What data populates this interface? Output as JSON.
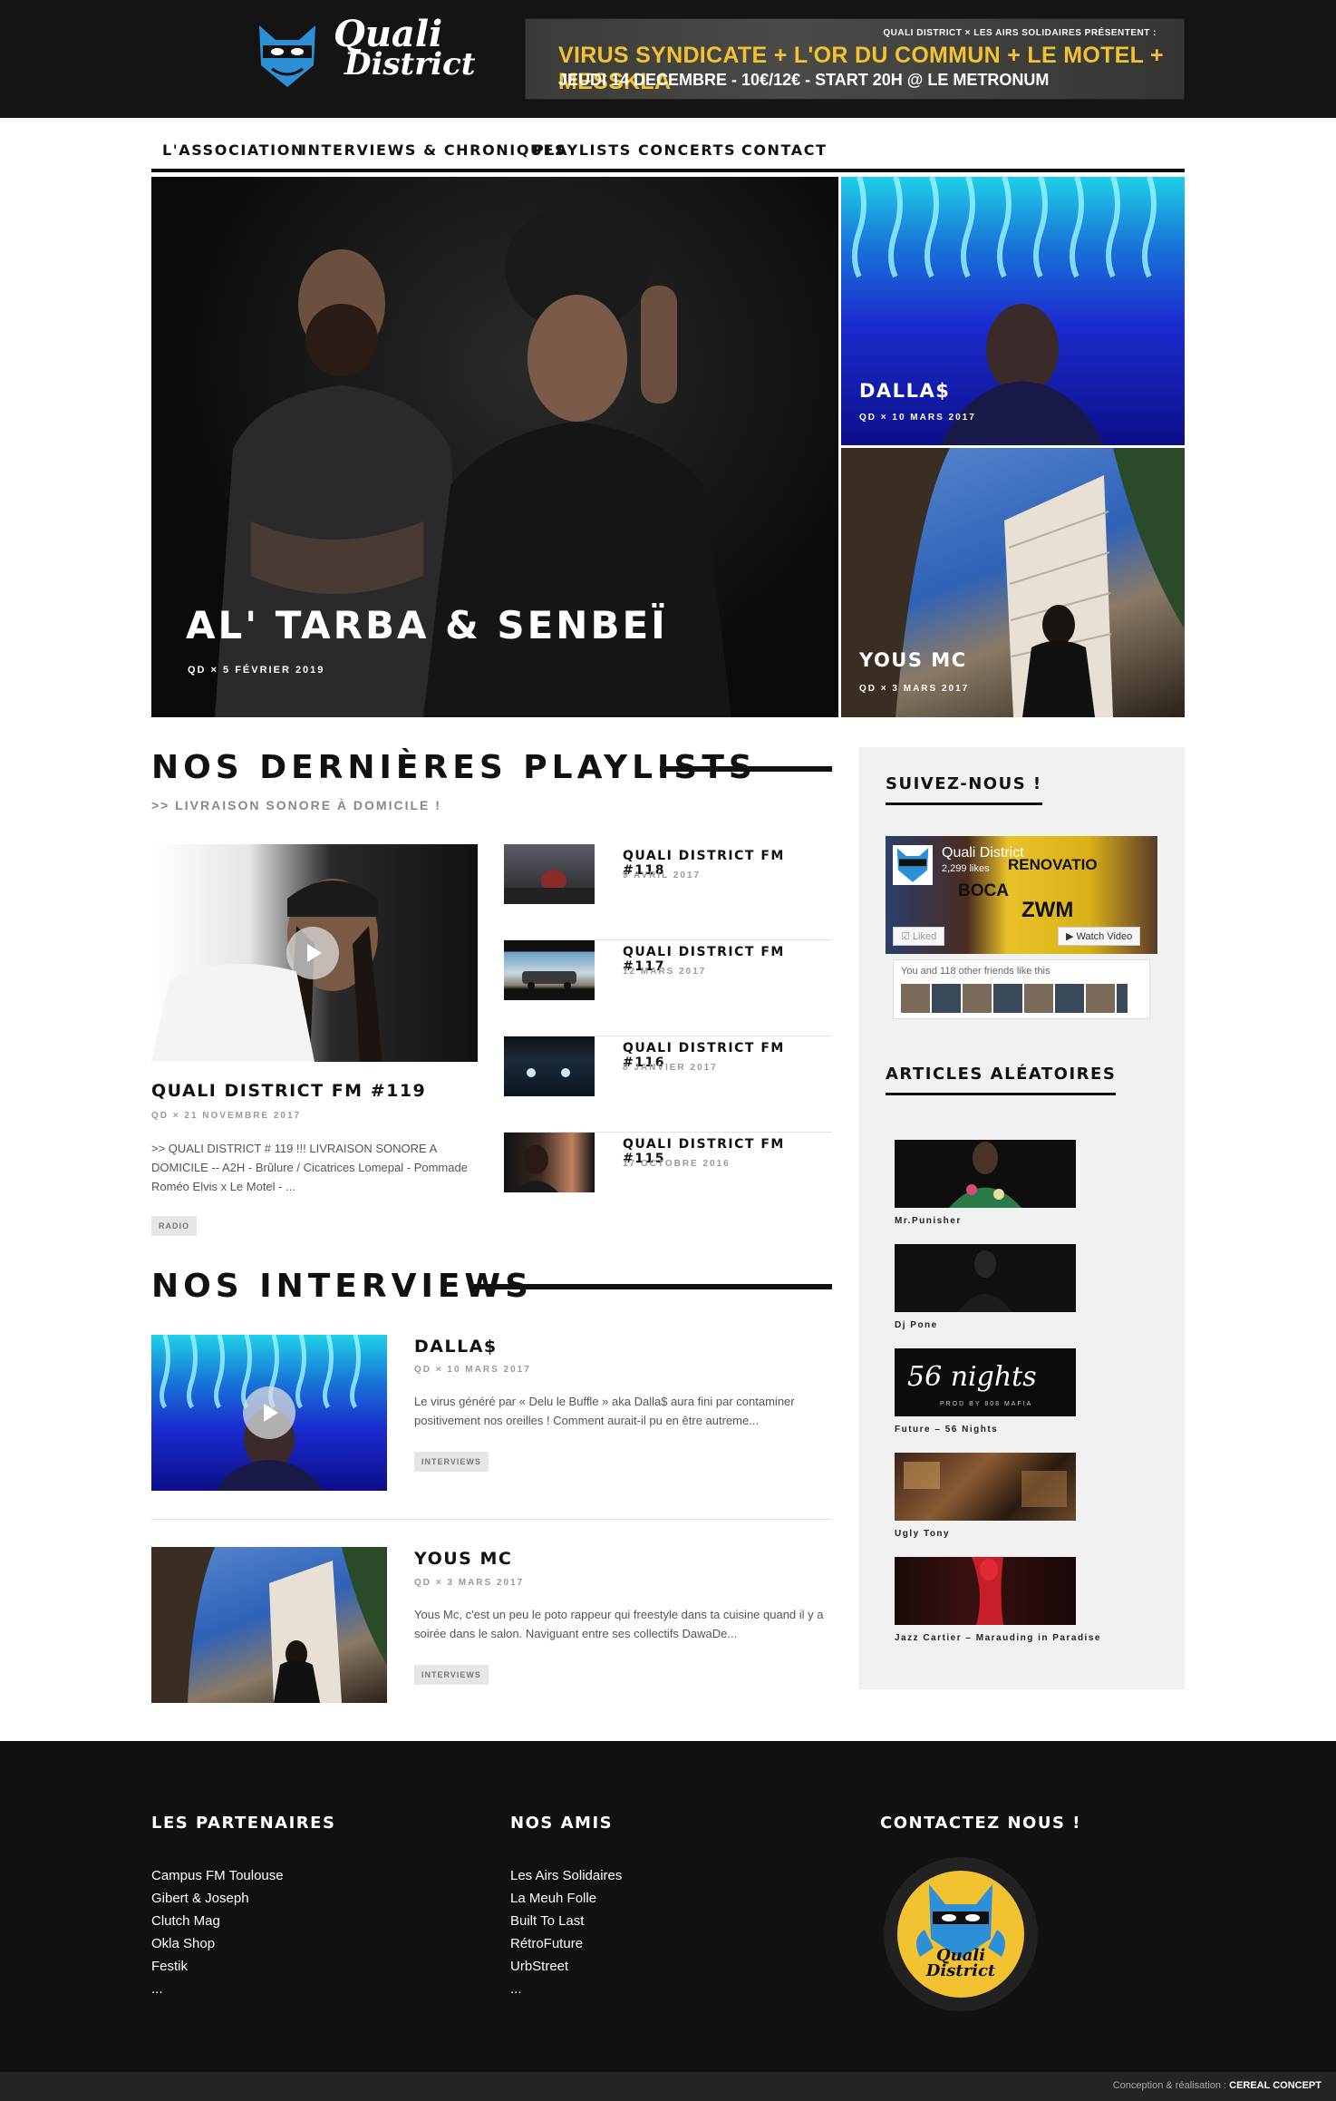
{
  "site": {
    "logo_line1": "Quali",
    "logo_line2": "District"
  },
  "banner": {
    "pre": "QUALI DISTRICT × LES AIRS SOLIDAIRES PRÉSENTENT :",
    "main": "VIRUS SYNDICATE + L'OR DU COMMUN + LE MOTEL + MESSKLA",
    "sub": "JEUDI 14 DECEMBRE - 10€/12€ - START 20H @ LE METRONUM"
  },
  "nav": [
    "L'ASSOCIATION",
    "INTERVIEWS & CHRONIQUES",
    "PLAYLISTS",
    "CONCERTS",
    "CONTACT"
  ],
  "hero": {
    "main": {
      "title": "AL' TARBA & SENBEÏ",
      "meta": "QD × 5 FÉVRIER 2019"
    },
    "dallas": {
      "title": "DALLA$",
      "meta": "QD × 10 MARS 2017"
    },
    "yous": {
      "title": "YOUS MC",
      "meta": "QD × 3 MARS 2017"
    }
  },
  "playlists": {
    "title": "NOS DERNIÈRES PLAYLISTS",
    "subtitle": ">> LIVRAISON SONORE À DOMICILE !",
    "featured": {
      "title": "QUALI DISTRICT FM #119",
      "meta": "QD × 21 NOVEMBRE 2017",
      "excerpt": ">> QUALI DISTRICT # 119 !!! LIVRAISON SONORE A DOMICILE -- A2H - Brûlure / Cicatrices Lomepal - Pommade Roméo Elvis x Le Motel - ...",
      "tag": "RADIO"
    },
    "items": [
      {
        "title": "QUALI DISTRICT FM #118",
        "date": "9 AVRIL 2017"
      },
      {
        "title": "QUALI DISTRICT FM #117",
        "date": "12 MARS 2017"
      },
      {
        "title": "QUALI DISTRICT FM #116",
        "date": "8 JANVIER 2017"
      },
      {
        "title": "QUALI DISTRICT FM #115",
        "date": "17 OCTOBRE 2016"
      }
    ]
  },
  "interviews": {
    "title": "NOS INTERVIEWS",
    "items": [
      {
        "title": "DALLA$",
        "meta": "QD × 10 MARS 2017",
        "excerpt": "Le virus généré par  « Delu le Buffle » aka Dalla$ aura fini par contaminer positivement nos oreilles ! Comment aurait-il pu en être autreme...",
        "tag": "INTERVIEWS"
      },
      {
        "title": "YOUS MC",
        "meta": "QD × 3 MARS 2017",
        "excerpt": "Yous Mc, c'est un peu le poto rappeur qui freestyle dans ta cuisine quand il y a soirée dans le salon. Naviguant entre ses collectifs DawaDe...",
        "tag": "INTERVIEWS"
      }
    ]
  },
  "sidebar": {
    "follow_title": "SUIVEZ-NOUS !",
    "fb": {
      "page": "Quali District",
      "likes": "2,299 likes",
      "liked": "Liked",
      "watch": "Watch Video",
      "friends": "You and 118 other friends like this",
      "cover_text1": "RENOVATIO",
      "cover_text2": "BOCA",
      "cover_text3": "ZWM"
    },
    "random_title": "ARTICLES ALÉATOIRES",
    "random": [
      "Mr.Punisher",
      "Dj Pone",
      "Future – 56 Nights",
      "Ugly Tony",
      "Jazz Cartier – Marauding in Paradise"
    ],
    "fifty_six_art": "56 nights",
    "fifty_six_sub": "PROD BY 808 MAFIA"
  },
  "footer": {
    "partners_title": "LES PARTENAIRES",
    "partners": [
      "Campus FM Toulouse",
      "Gibert & Joseph",
      "Clutch Mag",
      "Okla Shop",
      "Festik",
      "..."
    ],
    "friends_title": "NOS AMIS",
    "friends": [
      "Les Airs Solidaires",
      "La Meuh Folle",
      "Built To Last",
      "RétroFuture",
      "UrbStreet",
      "..."
    ],
    "contact_title": "CONTACTEZ NOUS !",
    "credit_prefix": "Conception & réalisation :",
    "credit_name": "CEREAL CONCEPT"
  },
  "colors": {
    "dark": "#141414",
    "accent_yellow": "#f2c230",
    "logo_blue": "#2d8fd6"
  }
}
